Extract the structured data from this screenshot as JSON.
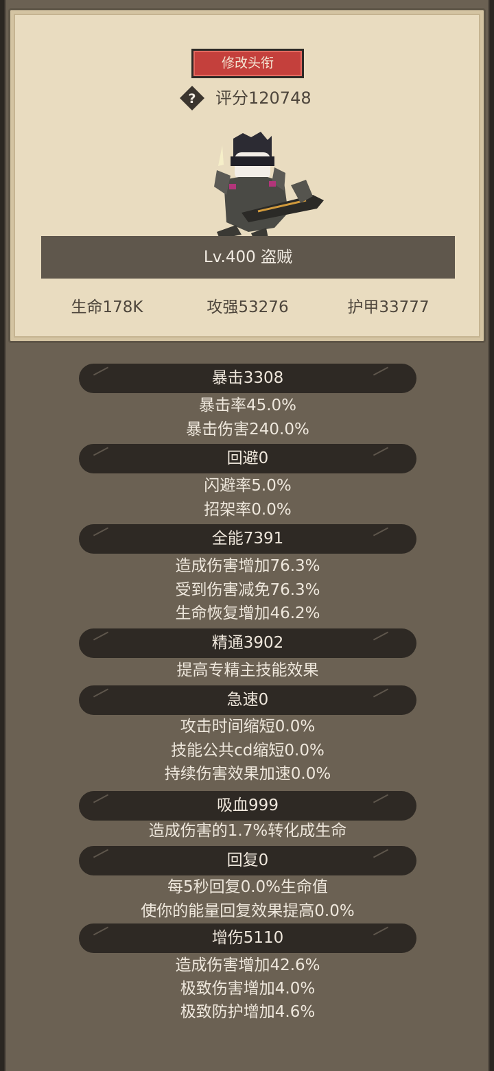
{
  "card": {
    "title_button": "修改头衔",
    "score": "评分120748",
    "level": "Lv.400 盗贼",
    "stats": {
      "hp": "生命178K",
      "attack": "攻强53276",
      "armor": "护甲33777"
    }
  },
  "sections": [
    {
      "header": "暴击3308",
      "details": [
        "暴击率45.0%",
        "暴击伤害240.0%"
      ]
    },
    {
      "header": "回避0",
      "details": [
        "闪避率5.0%",
        "招架率0.0%"
      ]
    },
    {
      "header": "全能7391",
      "details": [
        "造成伤害增加76.3%",
        "受到伤害减免76.3%",
        "生命恢复增加46.2%"
      ]
    },
    {
      "header": "精通3902",
      "details": [
        "提高专精主技能效果"
      ]
    },
    {
      "header": "急速0",
      "details": [
        "攻击时间缩短0.0%",
        "技能公共cd缩短0.0%",
        "持续伤害效果加速0.0%"
      ]
    },
    {
      "header": "吸血999",
      "details": [
        "造成伤害的1.7%转化成生命"
      ]
    },
    {
      "header": "回复0",
      "details": [
        "每5秒回复0.0%生命值",
        "使你的能量回复效果提高0.0%"
      ]
    },
    {
      "header": "增伤5110",
      "details": [
        "造成伤害增加42.6%",
        "极致伤害增加4.0%",
        "极致防护增加4.6%"
      ]
    }
  ],
  "colors": {
    "button_red": "#c4403c",
    "parchment": "#e9dcc0",
    "panel": "#6b6153",
    "bar": "#2e2924"
  }
}
